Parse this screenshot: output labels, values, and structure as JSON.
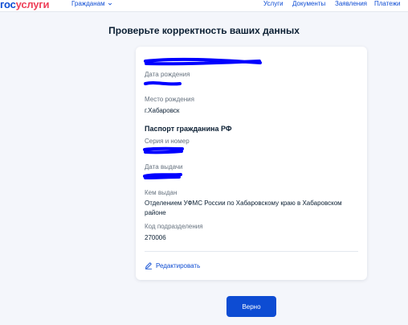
{
  "header": {
    "logo_part1": "гос",
    "logo_part2": "услуги",
    "citizens_menu": "Гражданам",
    "nav": [
      "Услуги",
      "Документы",
      "Заявления",
      "Платежи"
    ]
  },
  "page": {
    "title": "Проверьте корректность ваших данных"
  },
  "card": {
    "birth_date_label": "Дата рождения",
    "birth_place_label": "Место рождения",
    "birth_place_value": "г.Хабаровск",
    "passport_title": "Паспорт гражданина РФ",
    "series_label": "Серия и номер",
    "issue_date_label": "Дата выдачи",
    "issued_by_label": "Кем выдан",
    "issued_by_value": "Отделением УФМС России по Хабаровскому краю в Хабаровском районе",
    "division_code_label": "Код подразделения",
    "division_code_value": "270006",
    "edit_label": "Редактировать"
  },
  "actions": {
    "confirm_label": "Верно"
  },
  "colors": {
    "brand_blue": "#0d4cd3",
    "brand_red": "#ee3f58",
    "redaction": "#0000ff"
  }
}
